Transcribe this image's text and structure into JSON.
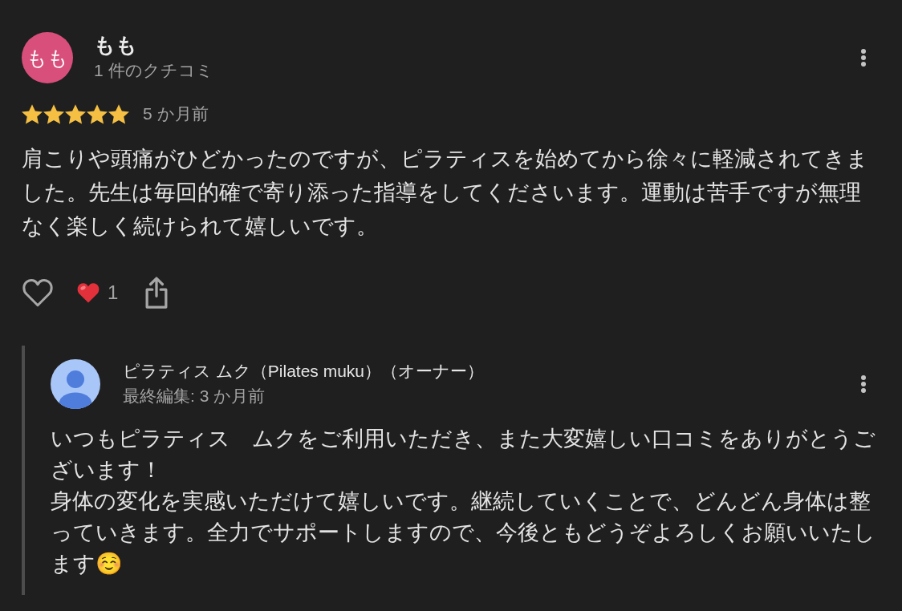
{
  "review": {
    "avatar_text": "もも",
    "author": "もも",
    "reviewer_stats": "1 件のクチコミ",
    "stars": 5,
    "time": "5 か月前",
    "text": "肩こりや頭痛がひどかったのですが、ピラティスを始めてから徐々に軽減されてきました。先生は毎回的確で寄り添った指導をしてくださいます。運動は苦手ですが無理なく楽しく続けられて嬉しいです。",
    "liked": false,
    "reaction_count": "1"
  },
  "owner_reply": {
    "name": "ピラティス ムク（Pilates muku）（オーナー）",
    "edited": "最終編集: 3 か月前",
    "paragraphs": [
      "いつもピラティス　ムクをご利用いただき、また大変嬉しい口コミをありがとうございます！",
      "身体の変化を実感いただけて嬉しいです。継続していくことで、どんどん身体は整っていきます。全力でサポートしますので、今後ともどうぞよろしくお願いいたします☺️"
    ]
  }
}
